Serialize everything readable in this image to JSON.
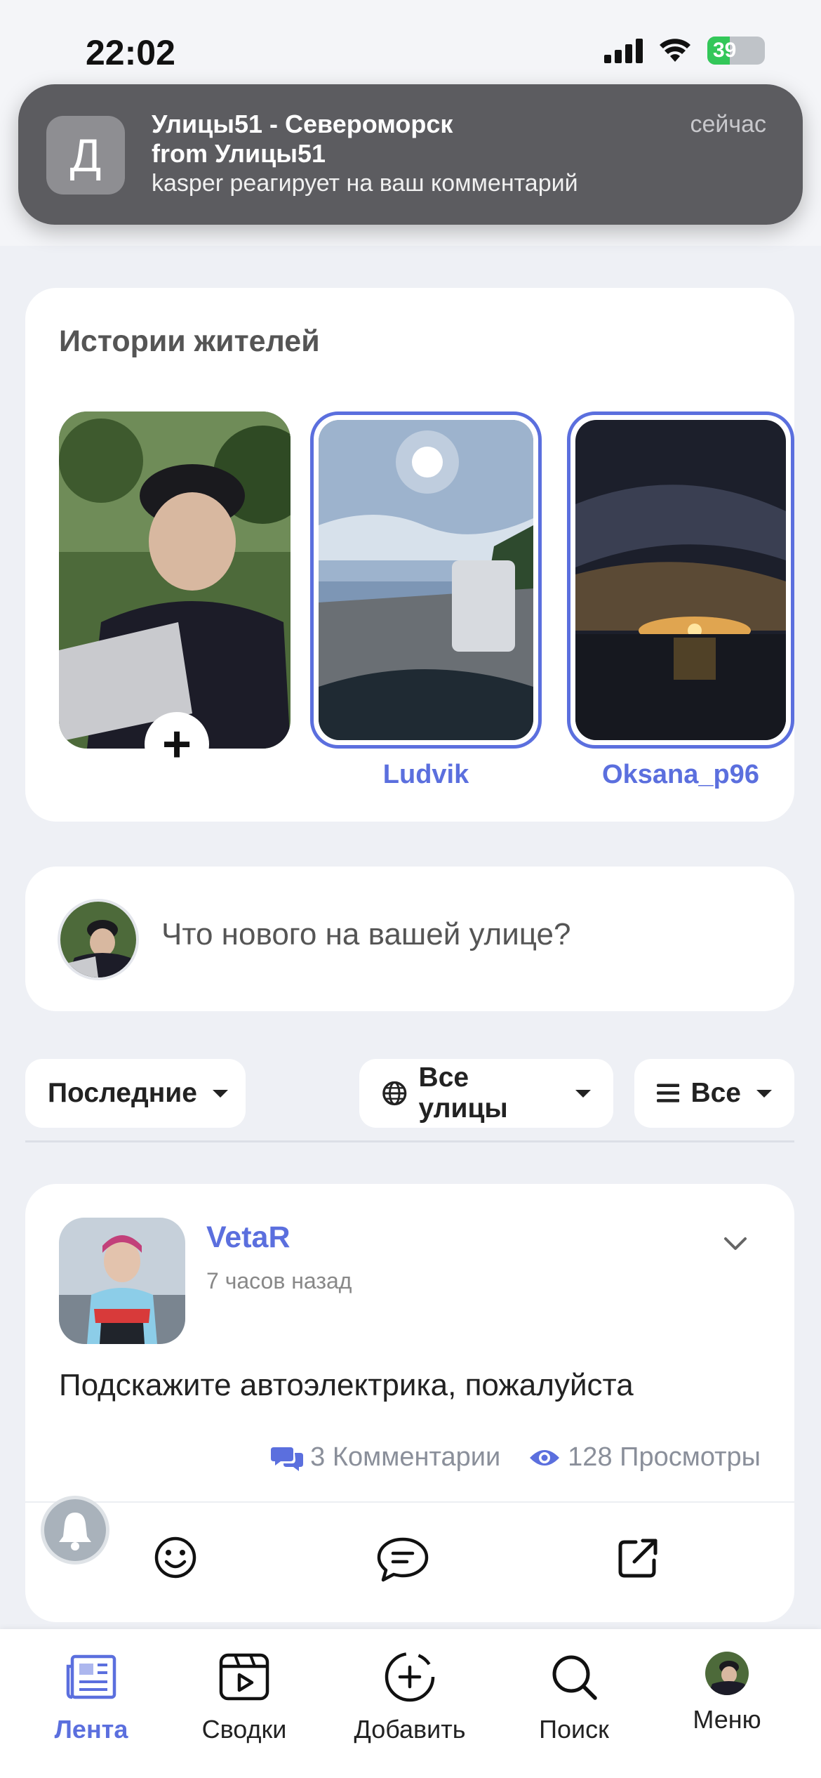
{
  "status_bar": {
    "time": "22:02",
    "battery": "39",
    "battery_level": 0.39
  },
  "notification": {
    "app_icon_letter": "Д",
    "title": "Улицы51 - Североморск",
    "subtitle": "from Улицы51",
    "body": "kasper реагирует на ваш комментарий",
    "time": "сейчас"
  },
  "stories": {
    "title": "Истории жителей",
    "items": [
      {
        "name": "",
        "own": true
      },
      {
        "name": "Ludvik"
      },
      {
        "name": "Oksana_p96"
      }
    ]
  },
  "composer": {
    "placeholder": "Что нового на вашей улице?"
  },
  "filters": {
    "sort": "Последние",
    "streets": "Все улицы",
    "type": "Все"
  },
  "post": {
    "author": "VetaR",
    "time": "7 часов назад",
    "text": "Подскажите автоэлектрика, пожалуйста",
    "comments": "3 Комментарии",
    "views": "128 Просмотры"
  },
  "tabbar": {
    "feed": "Лента",
    "summaries": "Сводки",
    "add": "Добавить",
    "search": "Поиск",
    "menu": "Меню"
  },
  "colors": {
    "accent": "#5b6fde",
    "background": "#eef0f5",
    "card": "#ffffff"
  }
}
